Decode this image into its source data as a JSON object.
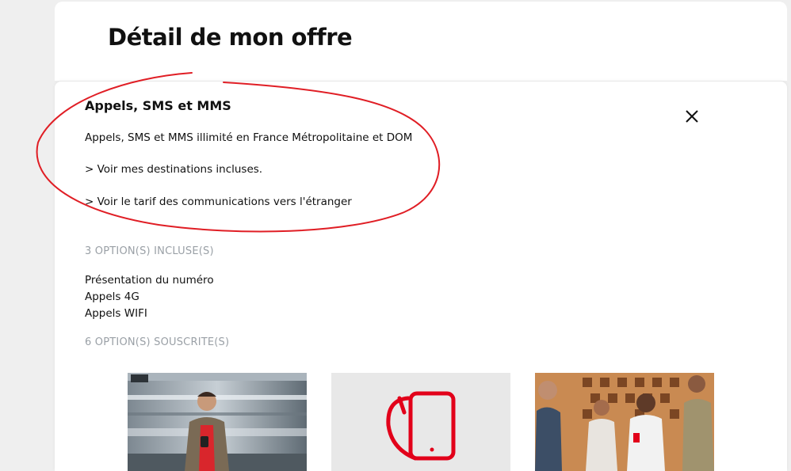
{
  "header": {
    "title": "Détail de mon offre"
  },
  "section": {
    "title": "Appels, SMS et MMS",
    "description": "Appels, SMS et MMS illimité en France Métropolitaine et DOM",
    "link_destinations": "> Voir mes destinations incluses.",
    "link_rates": "> Voir le tarif des communications vers l'étranger"
  },
  "included": {
    "heading": "3 OPTION(S) INCLUSE(S)",
    "items": [
      "Présentation du numéro",
      "Appels 4G",
      "Appels WIFI"
    ]
  },
  "subscribed": {
    "heading": "6 OPTION(S) SOUSCRITE(S)"
  },
  "cards": [
    {
      "icon": "man-on-train-platform-photo"
    },
    {
      "icon": "phone-call-icon"
    },
    {
      "icon": "group-with-phones-photo"
    }
  ],
  "colors": {
    "annotation": "#e01e25",
    "brand_red": "#e2001a",
    "muted": "#9aa0a6"
  }
}
